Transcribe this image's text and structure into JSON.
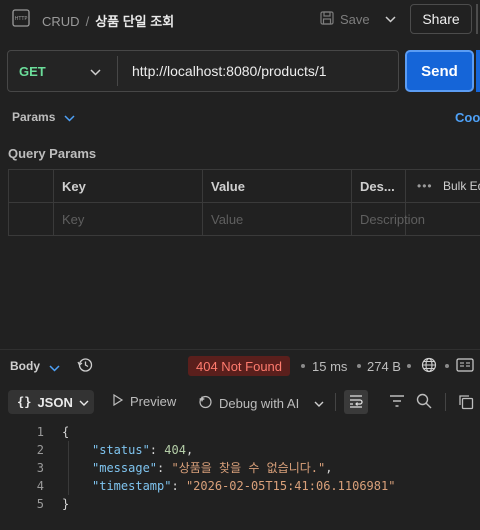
{
  "header": {
    "breadcrumb_parent": "CRUD",
    "breadcrumb_sep": "/",
    "breadcrumb_current": "상품 단일 조회",
    "save_label": "Save",
    "share_label": "Share"
  },
  "request": {
    "method": "GET",
    "url": "http://localhost:8080/products/1",
    "send_label": "Send"
  },
  "tabs": {
    "params_label": "Params",
    "cookies_label": "Cook"
  },
  "query_params": {
    "title": "Query Params",
    "headers": {
      "key": "Key",
      "value": "Value",
      "description": "Des...",
      "bulk_edit": "Bulk Ed",
      "dots": "•••"
    },
    "placeholders": {
      "key": "Key",
      "value": "Value",
      "description": "Description"
    }
  },
  "response": {
    "body_label": "Body",
    "status": "404 Not Found",
    "time": "15 ms",
    "size": "274 B",
    "format_label": "JSON",
    "format_icon": "{}",
    "preview_label": "Preview",
    "debug_label": "Debug with AI",
    "code_lines": [
      {
        "n": "1",
        "text": "{"
      },
      {
        "n": "2",
        "key": "\"status\"",
        "sep": ": ",
        "value": "404",
        "kind": "num",
        "tail": ","
      },
      {
        "n": "3",
        "key": "\"message\"",
        "sep": ": ",
        "value": "\"상품을 찾을 수 없습니다.\"",
        "kind": "str",
        "tail": ","
      },
      {
        "n": "4",
        "key": "\"timestamp\"",
        "sep": ": ",
        "value": "\"2026-02-05T15:41:06.1106981\"",
        "kind": "str",
        "tail": ""
      },
      {
        "n": "5",
        "text": "}"
      }
    ]
  },
  "colors": {
    "accent": "#1565d8",
    "method": "#6bdd9a",
    "error_bg": "#5a1f1c",
    "error_text": "#ff7b6e",
    "link": "#4ea1f7"
  }
}
